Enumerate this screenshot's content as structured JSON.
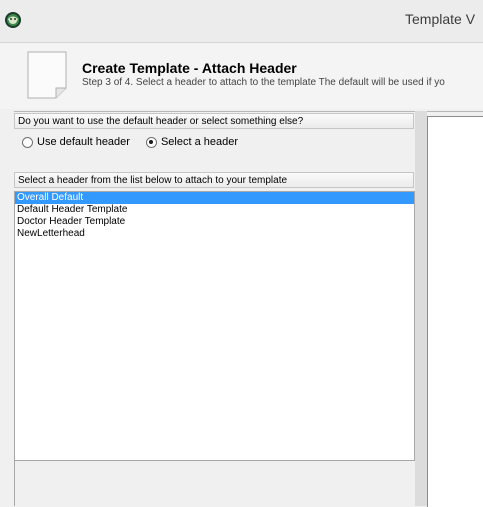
{
  "window": {
    "title": "Template V"
  },
  "wizard": {
    "title": "Create Template - Attach Header",
    "step_text": "Step 3 of 4. Select a header to attach to the template The default will be used if yo"
  },
  "header_choice": {
    "question": "Do you want to use the default header or select something else?",
    "options": [
      {
        "label": "Use default header",
        "checked": false
      },
      {
        "label": "Select a header",
        "checked": true
      }
    ]
  },
  "header_list": {
    "label": "Select a header from the list below to attach to your template",
    "items": [
      {
        "label": "Overall Default",
        "selected": true
      },
      {
        "label": "Default Header Template",
        "selected": false
      },
      {
        "label": "Doctor Header Template",
        "selected": false
      },
      {
        "label": "NewLetterhead",
        "selected": false
      }
    ]
  },
  "colors": {
    "selection": "#3399ff",
    "list_background": "#ffffff",
    "window_background": "#f0f0f0"
  },
  "icons": {
    "app": "app-logo-icon",
    "wizard": "document-icon"
  }
}
